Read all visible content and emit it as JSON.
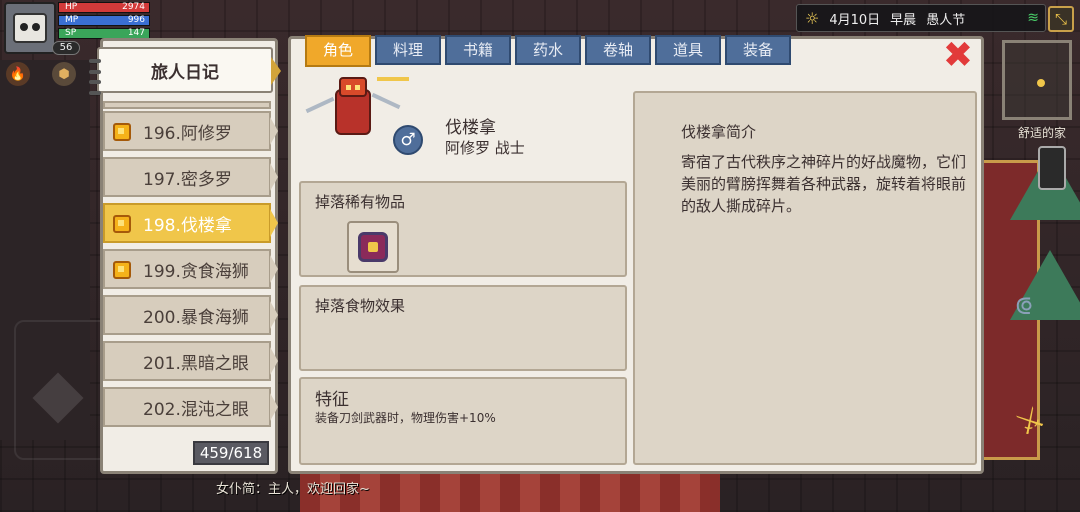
{
  "hud": {
    "hp_label": "HP",
    "hp_value": "2974",
    "mp_label": "MP",
    "mp_value": "996",
    "sp_label": "SP",
    "sp_value": "147",
    "level": "56"
  },
  "topbar": {
    "date": "4月10日",
    "time_of_day": "早晨",
    "event": "愚人节"
  },
  "map": {
    "location_label": "舒适的家"
  },
  "chat": {
    "line": "女仆简：主人，欢迎回家~"
  },
  "journal": {
    "title": "旅人日记",
    "entries": [
      {
        "label": "196.阿修罗",
        "gem": true,
        "selected": false
      },
      {
        "label": "197.密多罗",
        "gem": false,
        "selected": false
      },
      {
        "label": "198.伐楼拿",
        "gem": true,
        "selected": true
      },
      {
        "label": "199.贪食海狮",
        "gem": true,
        "selected": false
      },
      {
        "label": "200.暴食海狮",
        "gem": false,
        "selected": false
      },
      {
        "label": "201.黑暗之眼",
        "gem": false,
        "selected": false
      },
      {
        "label": "202.混沌之眼",
        "gem": false,
        "selected": false
      }
    ],
    "count": "459/618"
  },
  "tabs": [
    "角色",
    "料理",
    "书籍",
    "药水",
    "卷轴",
    "道具",
    "装备"
  ],
  "active_tab": "角色",
  "character": {
    "name": "伐楼拿",
    "class": "阿修罗 战士",
    "gender_symbol": "♂"
  },
  "sections": {
    "drops_title": "掉落稀有物品",
    "food_title": "掉落食物效果",
    "traits_title": "特征",
    "traits_desc": "装备刀剑武器时，物理伤害+10%"
  },
  "intro": {
    "title": "伐楼拿简介",
    "text": "寄宿了古代秩序之神碎片的好战魔物，它们美丽的臂膀挥舞着各种武器，旋转着将眼前的敌人撕成碎片。"
  },
  "colors": {
    "accent_orange": "#f0a82a",
    "tab_blue": "#4f6e9a",
    "selected_entry": "#f0c64a",
    "close_red": "#e23a3a"
  }
}
